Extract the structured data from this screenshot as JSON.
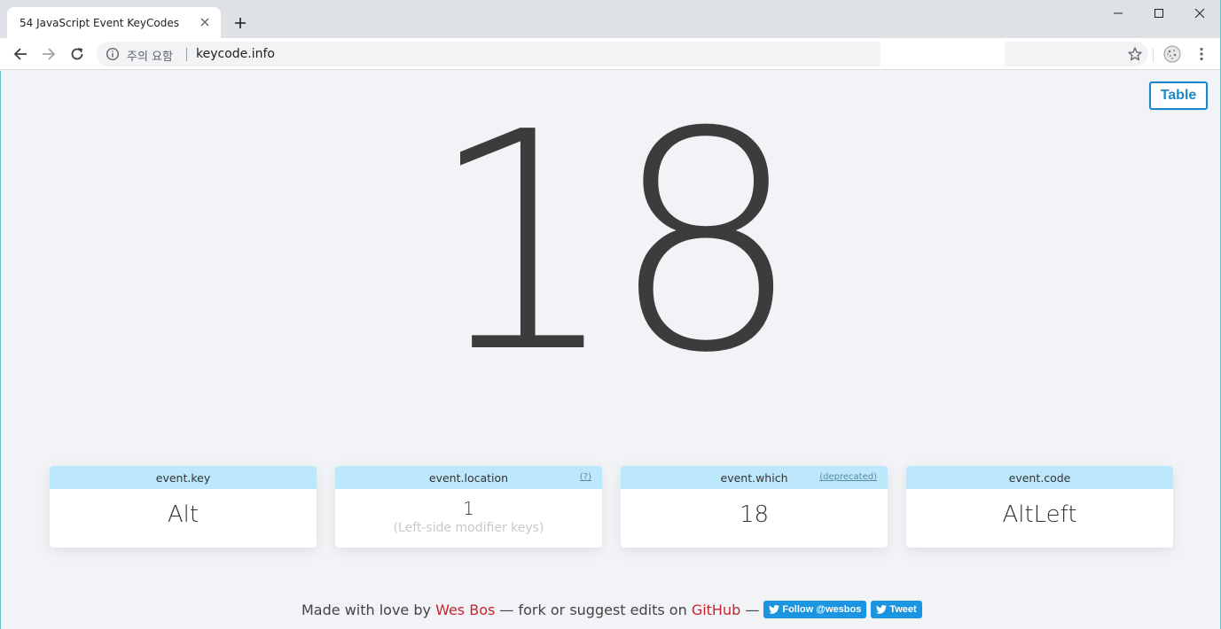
{
  "browser": {
    "tab_title": "54  JavaScript Event KeyCodes",
    "security_label": "주의 요함",
    "url": "keycode.info",
    "icons": {
      "back": "back-arrow-icon",
      "forward": "forward-arrow-icon",
      "reload": "reload-icon",
      "info": "info-icon",
      "bookmark": "star-icon",
      "menu": "kebab-menu-icon"
    }
  },
  "page": {
    "table_button": "Table",
    "keycode": "18",
    "cards": [
      {
        "label": "event.key",
        "value": "Alt"
      },
      {
        "label": "event.location",
        "link": "(?)",
        "value": "1",
        "note": "(Left-side modifier keys)"
      },
      {
        "label": "event.which",
        "link": "(deprecated)",
        "value": "18"
      },
      {
        "label": "event.code",
        "value": "AltLeft"
      }
    ],
    "footer": {
      "prefix": "Made with love by",
      "author": "Wes Bos",
      "middle": "— fork or suggest edits on",
      "github": "GitHub",
      "dash": "—",
      "follow_button": "Follow @wesbos",
      "tweet_button": "Tweet"
    }
  },
  "colors": {
    "accent": "#1d88c9",
    "card_header": "#bde7fb",
    "link_red": "#c8232c",
    "twitter": "#1b95e0"
  }
}
